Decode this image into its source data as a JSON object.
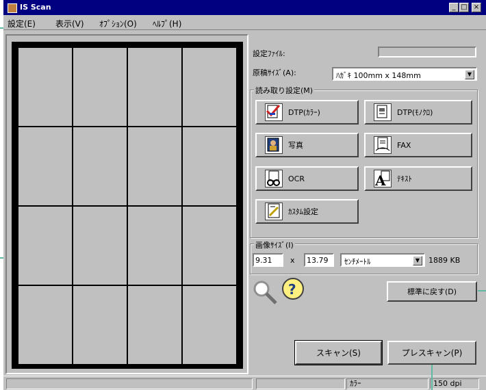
{
  "window": {
    "title": "IS Scan",
    "minimize": "_",
    "maximize": "□",
    "close": "×"
  },
  "menubar": [
    "設定(E)",
    "表示(V)",
    "ｵﾌﾟｼｮﾝ(O)",
    "ﾍﾙﾌﾟ(H)"
  ],
  "settings": {
    "settings_file_label": "設定ﾌｧｲﾙ:",
    "settings_file_value": "",
    "doc_size_label": "原稿ｻｲｽﾞ(A):",
    "doc_size_value": "ﾊｶﾞｷ 100mm x 148mm",
    "read_group_label": "読み取り設定(M)"
  },
  "modes": [
    {
      "label": "DTP(ｶﾗｰ)",
      "icon": "dtp-color-icon"
    },
    {
      "label": "DTP(ﾓﾉｸﾛ)",
      "icon": "dtp-mono-icon"
    },
    {
      "label": "写真",
      "icon": "photo-icon"
    },
    {
      "label": "FAX",
      "icon": "fax-icon"
    },
    {
      "label": "OCR",
      "icon": "ocr-icon"
    },
    {
      "label": "ﾃｷｽﾄ",
      "icon": "text-icon"
    },
    {
      "label": "ｶｽﾀﾑ設定",
      "icon": "custom-settings-icon"
    }
  ],
  "image_size": {
    "group_label": "画像ｻｲｽﾞ(I)",
    "width": "9.31",
    "times": "x",
    "height": "13.79",
    "unit": "ｾﾝﾁﾒｰﾄﾙ",
    "filesize": "1889 KB"
  },
  "buttons": {
    "reset": "標準に戻す(D)",
    "scan": "スキャン(S)",
    "prescan": "プレスキャン(P)"
  },
  "status": {
    "color_mode": "ｶﾗｰ",
    "resolution": "150 dpi"
  }
}
